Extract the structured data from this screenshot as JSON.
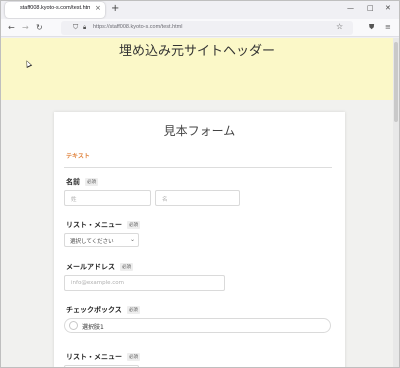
{
  "browser": {
    "tab_title": "staff008.kyoto-s.com/test.html",
    "tab_close": "×",
    "new_tab": "+",
    "url": "https://staff008.kyoto-s.com/test.html",
    "win_minimize": "—",
    "win_maximize": "□",
    "win_close": "✕"
  },
  "page": {
    "header_title": "埋め込み元サイトヘッダー",
    "form_title": "見本フォーム",
    "section_label": "テキスト",
    "fields": {
      "name_label": "名前",
      "name_badge": "必須",
      "last_name_placeholder": "姓",
      "first_name_placeholder": "名",
      "list_label": "リスト・メニュー",
      "list_badge": "必須",
      "list_value": "選択してください",
      "email_label": "メールアドレス",
      "email_badge": "必須",
      "email_placeholder": "info@example.com",
      "checkbox_label": "チェックボックス",
      "checkbox_badge": "必須",
      "checkbox_option": "選択肢1",
      "list2_label": "リスト・メニュー",
      "list2_badge": "必須"
    }
  },
  "colors": {
    "header_bg": "#fbf8c8",
    "section_accent": "#e0823c",
    "page_bg": "#f1f1ef"
  }
}
